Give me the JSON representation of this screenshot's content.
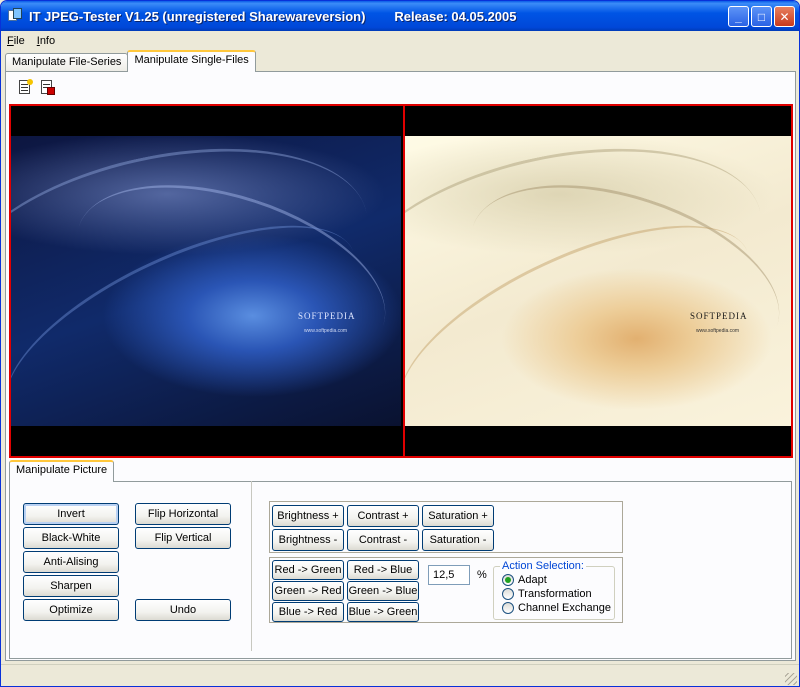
{
  "window": {
    "title": "IT JPEG-Tester V1.25 (unregistered Sharewareversion)        Release: 04.05.2005",
    "minimize": "_",
    "maximize": "□",
    "close": "✕"
  },
  "menu": {
    "file_key": "F",
    "file_rest": "ile",
    "info_key": "I",
    "info_rest": "nfo"
  },
  "tabs": [
    {
      "label": "Manipulate File-Series",
      "active": false
    },
    {
      "label": "Manipulate Single-Files",
      "active": true
    }
  ],
  "toolbar": [
    {
      "icon": "new-document-icon"
    },
    {
      "icon": "save-document-icon"
    }
  ],
  "images": {
    "left_logo": "SOFTPEDIA",
    "left_url": "www.softpedia.com",
    "right_logo": "SOFTPEDIA",
    "right_url": "www.softpedia.com"
  },
  "group_tab": "Manipulate Picture",
  "buttons": {
    "invert": "Invert",
    "black_white": "Black-White",
    "anti_aliasing": "Anti-Alising",
    "sharpen": "Sharpen",
    "optimize": "Optimize",
    "flip_horizontal": "Flip Horizontal",
    "flip_vertical": "Flip Vertical",
    "undo": "Undo",
    "brightness_plus": "Brightness +",
    "contrast_plus": "Contrast +",
    "saturation_plus": "Saturation +",
    "brightness_minus": "Brightness -",
    "contrast_minus": "Contrast -",
    "saturation_minus": "Saturation -",
    "red_green": "Red -> Green",
    "red_blue": "Red -> Blue",
    "green_red": "Green -> Red",
    "green_blue": "Green -> Blue",
    "blue_red": "Blue -> Red",
    "blue_green": "Blue -> Green"
  },
  "amount": {
    "value": "12,5",
    "unit": "%"
  },
  "action_selection": {
    "legend": "Action Selection:",
    "options": [
      {
        "label": "Adapt",
        "selected": true
      },
      {
        "label": "Transformation",
        "selected": false
      },
      {
        "label": "Channel Exchange",
        "selected": false
      }
    ]
  },
  "colors": {
    "title_bar": "#0055e5",
    "image_border": "#e00000",
    "tab_highlight": "#ffc73c",
    "legend": "#0046d5",
    "radio_dot": "#21a121"
  }
}
